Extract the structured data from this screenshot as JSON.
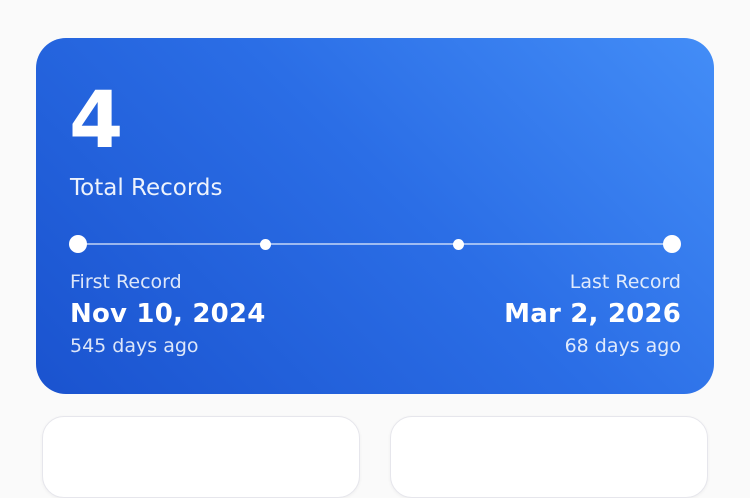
{
  "summary": {
    "total_count": "4",
    "total_label": "Total Records",
    "first": {
      "label": "First Record",
      "date": "Nov 10, 2024",
      "ago": "545 days ago"
    },
    "last": {
      "label": "Last Record",
      "date": "Mar 2, 2026",
      "ago": "68 days ago"
    }
  },
  "colors": {
    "card_gradient_start": "#438df7",
    "card_gradient_end": "#1a53cf",
    "background": "#fafafa"
  }
}
